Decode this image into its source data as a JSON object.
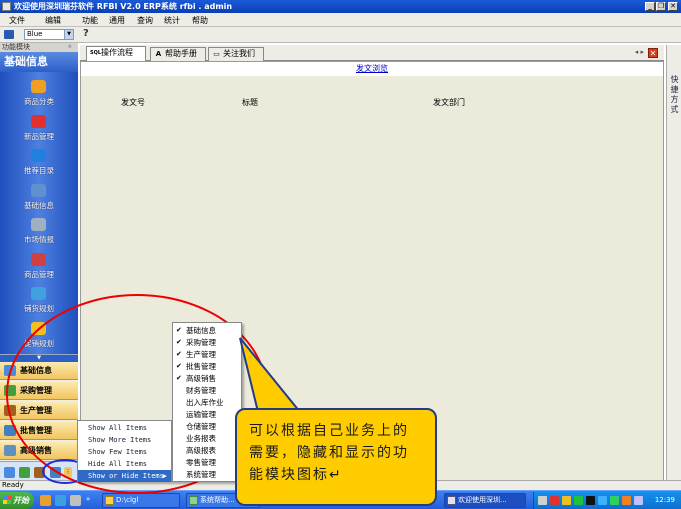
{
  "window": {
    "title": "欢迎使用深圳瑞芬软件 RFBI V2.0 ERP系统 rfbi . admin",
    "buttons": [
      "_",
      "❐",
      "✕"
    ]
  },
  "menubar": {
    "items": [
      "文件",
      "编辑",
      "功能",
      "通用",
      "查询",
      "统计",
      "帮助"
    ]
  },
  "toolbar": {
    "theme_value": "Blue"
  },
  "left_panel": {
    "header": "功能模块",
    "title": "基础信息",
    "items": [
      {
        "label": "商品分类",
        "color": "#f0a020"
      },
      {
        "label": "新品管理",
        "color": "#e03030"
      },
      {
        "label": "推荐目录",
        "color": "#2080e0"
      },
      {
        "label": "基础信息",
        "color": "#6090d0"
      },
      {
        "label": "市场情报",
        "color": "#a0b0c0"
      },
      {
        "label": "商品管理",
        "color": "#d04040"
      },
      {
        "label": "铺货规划",
        "color": "#40a0e0"
      },
      {
        "label": "促销规划",
        "color": "#f0c020"
      }
    ],
    "groups": [
      {
        "label": "基础信息",
        "color": "#4a8ae0"
      },
      {
        "label": "采购管理",
        "color": "#40a040"
      },
      {
        "label": "生产管理",
        "color": "#a06020"
      },
      {
        "label": "批售管理",
        "color": "#4080c0"
      },
      {
        "label": "高级销售",
        "color": "#6090c0"
      }
    ]
  },
  "tabs": [
    {
      "label": "操作流程",
      "icon": "sql-icon",
      "glyph": "SQL"
    },
    {
      "label": "帮助手册",
      "icon": "font-a-icon",
      "glyph": "A"
    },
    {
      "label": "关注我们",
      "icon": "folder-icon",
      "glyph": "▭"
    }
  ],
  "content": {
    "link": "发文浏览",
    "columns": [
      "发文号",
      "标题",
      "发文部门"
    ]
  },
  "right_strip": {
    "label": "快捷方式"
  },
  "statusbar": {
    "text": "Ready"
  },
  "popup_menu": {
    "items": [
      "Show All Items",
      "Show More Items",
      "Show Few Items",
      "Hide All Items",
      "Show or Hide Items"
    ]
  },
  "submenu": {
    "items": [
      {
        "label": "基础信息",
        "checked": true
      },
      {
        "label": "采购管理",
        "checked": true
      },
      {
        "label": "生产管理",
        "checked": true
      },
      {
        "label": "批售管理",
        "checked": true
      },
      {
        "label": "高级销售",
        "checked": true
      },
      {
        "label": "财务管理",
        "checked": false
      },
      {
        "label": "出入库作业",
        "checked": false
      },
      {
        "label": "运输管理",
        "checked": false
      },
      {
        "label": "仓储管理",
        "checked": false
      },
      {
        "label": "业务报表",
        "checked": false
      },
      {
        "label": "高级报表",
        "checked": false
      },
      {
        "label": "零售管理",
        "checked": false
      },
      {
        "label": "系统管理",
        "checked": false
      }
    ]
  },
  "callout": {
    "text": "可以根据自己业务上的需要，隐藏和显示的功能模块图标↵"
  },
  "taskbar": {
    "start_label": "开始",
    "tasks": [
      "D:\\clgl",
      "系统帮助...",
      "欢迎使用深圳..."
    ],
    "clock": "12:39"
  }
}
